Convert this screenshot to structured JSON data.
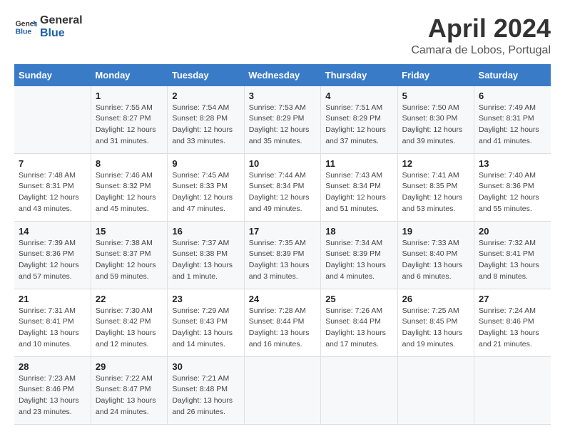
{
  "header": {
    "logo_line1": "General",
    "logo_line2": "Blue",
    "title": "April 2024",
    "subtitle": "Camara de Lobos, Portugal"
  },
  "days_of_week": [
    "Sunday",
    "Monday",
    "Tuesday",
    "Wednesday",
    "Thursday",
    "Friday",
    "Saturday"
  ],
  "weeks": [
    [
      {
        "num": "",
        "detail": ""
      },
      {
        "num": "1",
        "detail": "Sunrise: 7:55 AM\nSunset: 8:27 PM\nDaylight: 12 hours\nand 31 minutes."
      },
      {
        "num": "2",
        "detail": "Sunrise: 7:54 AM\nSunset: 8:28 PM\nDaylight: 12 hours\nand 33 minutes."
      },
      {
        "num": "3",
        "detail": "Sunrise: 7:53 AM\nSunset: 8:29 PM\nDaylight: 12 hours\nand 35 minutes."
      },
      {
        "num": "4",
        "detail": "Sunrise: 7:51 AM\nSunset: 8:29 PM\nDaylight: 12 hours\nand 37 minutes."
      },
      {
        "num": "5",
        "detail": "Sunrise: 7:50 AM\nSunset: 8:30 PM\nDaylight: 12 hours\nand 39 minutes."
      },
      {
        "num": "6",
        "detail": "Sunrise: 7:49 AM\nSunset: 8:31 PM\nDaylight: 12 hours\nand 41 minutes."
      }
    ],
    [
      {
        "num": "7",
        "detail": "Sunrise: 7:48 AM\nSunset: 8:31 PM\nDaylight: 12 hours\nand 43 minutes."
      },
      {
        "num": "8",
        "detail": "Sunrise: 7:46 AM\nSunset: 8:32 PM\nDaylight: 12 hours\nand 45 minutes."
      },
      {
        "num": "9",
        "detail": "Sunrise: 7:45 AM\nSunset: 8:33 PM\nDaylight: 12 hours\nand 47 minutes."
      },
      {
        "num": "10",
        "detail": "Sunrise: 7:44 AM\nSunset: 8:34 PM\nDaylight: 12 hours\nand 49 minutes."
      },
      {
        "num": "11",
        "detail": "Sunrise: 7:43 AM\nSunset: 8:34 PM\nDaylight: 12 hours\nand 51 minutes."
      },
      {
        "num": "12",
        "detail": "Sunrise: 7:41 AM\nSunset: 8:35 PM\nDaylight: 12 hours\nand 53 minutes."
      },
      {
        "num": "13",
        "detail": "Sunrise: 7:40 AM\nSunset: 8:36 PM\nDaylight: 12 hours\nand 55 minutes."
      }
    ],
    [
      {
        "num": "14",
        "detail": "Sunrise: 7:39 AM\nSunset: 8:36 PM\nDaylight: 12 hours\nand 57 minutes."
      },
      {
        "num": "15",
        "detail": "Sunrise: 7:38 AM\nSunset: 8:37 PM\nDaylight: 12 hours\nand 59 minutes."
      },
      {
        "num": "16",
        "detail": "Sunrise: 7:37 AM\nSunset: 8:38 PM\nDaylight: 13 hours\nand 1 minute."
      },
      {
        "num": "17",
        "detail": "Sunrise: 7:35 AM\nSunset: 8:39 PM\nDaylight: 13 hours\nand 3 minutes."
      },
      {
        "num": "18",
        "detail": "Sunrise: 7:34 AM\nSunset: 8:39 PM\nDaylight: 13 hours\nand 4 minutes."
      },
      {
        "num": "19",
        "detail": "Sunrise: 7:33 AM\nSunset: 8:40 PM\nDaylight: 13 hours\nand 6 minutes."
      },
      {
        "num": "20",
        "detail": "Sunrise: 7:32 AM\nSunset: 8:41 PM\nDaylight: 13 hours\nand 8 minutes."
      }
    ],
    [
      {
        "num": "21",
        "detail": "Sunrise: 7:31 AM\nSunset: 8:41 PM\nDaylight: 13 hours\nand 10 minutes."
      },
      {
        "num": "22",
        "detail": "Sunrise: 7:30 AM\nSunset: 8:42 PM\nDaylight: 13 hours\nand 12 minutes."
      },
      {
        "num": "23",
        "detail": "Sunrise: 7:29 AM\nSunset: 8:43 PM\nDaylight: 13 hours\nand 14 minutes."
      },
      {
        "num": "24",
        "detail": "Sunrise: 7:28 AM\nSunset: 8:44 PM\nDaylight: 13 hours\nand 16 minutes."
      },
      {
        "num": "25",
        "detail": "Sunrise: 7:26 AM\nSunset: 8:44 PM\nDaylight: 13 hours\nand 17 minutes."
      },
      {
        "num": "26",
        "detail": "Sunrise: 7:25 AM\nSunset: 8:45 PM\nDaylight: 13 hours\nand 19 minutes."
      },
      {
        "num": "27",
        "detail": "Sunrise: 7:24 AM\nSunset: 8:46 PM\nDaylight: 13 hours\nand 21 minutes."
      }
    ],
    [
      {
        "num": "28",
        "detail": "Sunrise: 7:23 AM\nSunset: 8:46 PM\nDaylight: 13 hours\nand 23 minutes."
      },
      {
        "num": "29",
        "detail": "Sunrise: 7:22 AM\nSunset: 8:47 PM\nDaylight: 13 hours\nand 24 minutes."
      },
      {
        "num": "30",
        "detail": "Sunrise: 7:21 AM\nSunset: 8:48 PM\nDaylight: 13 hours\nand 26 minutes."
      },
      {
        "num": "",
        "detail": ""
      },
      {
        "num": "",
        "detail": ""
      },
      {
        "num": "",
        "detail": ""
      },
      {
        "num": "",
        "detail": ""
      }
    ]
  ]
}
